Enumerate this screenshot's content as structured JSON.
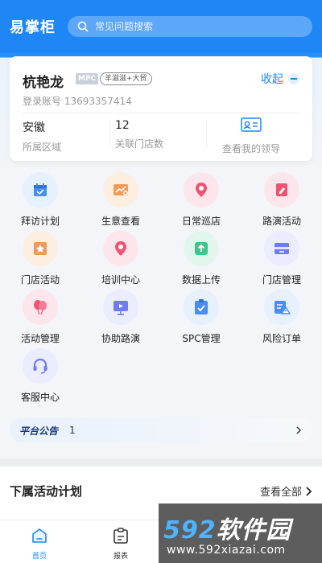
{
  "app": {
    "title": "易掌柜"
  },
  "search": {
    "placeholder": "常见问题搜索"
  },
  "profile": {
    "name": "杭艳龙",
    "role_badge": "MPC",
    "tag": "羊滋滋+大贸",
    "collapse_label": "收起",
    "account_label": "登录账号",
    "account_value": "13693357414",
    "region_value": "安徽",
    "region_label": "所属区域",
    "stores_value": "12",
    "stores_label": "关联门店数",
    "leader_label": "查看我的领导"
  },
  "menu": [
    {
      "label": "拜访计划",
      "icon": "calendar-icon",
      "color": "#4a8df2",
      "bg": "#e7f0fd"
    },
    {
      "label": "生意查看",
      "icon": "business-chart-icon",
      "color": "#f29a55",
      "bg": "#fdeee2"
    },
    {
      "label": "日常巡店",
      "icon": "location-pin-icon",
      "color": "#ee5472",
      "bg": "#fde6eb"
    },
    {
      "label": "路演活动",
      "icon": "edit-note-icon",
      "color": "#ee5472",
      "bg": "#fde6eb"
    },
    {
      "label": "门店活动",
      "icon": "star-card-icon",
      "color": "#f29a55",
      "bg": "#fdeee2"
    },
    {
      "label": "培训中心",
      "icon": "location-pin-icon",
      "color": "#ee5472",
      "bg": "#fde6eb"
    },
    {
      "label": "数据上传",
      "icon": "upload-icon",
      "color": "#3cc58d",
      "bg": "#e3f6ed"
    },
    {
      "label": "门店管理",
      "icon": "store-card-icon",
      "color": "#6f7bf0",
      "bg": "#ebecfd"
    },
    {
      "label": "活动管理",
      "icon": "balloons-icon",
      "color": "#ee5472",
      "bg": "#fde6eb"
    },
    {
      "label": "协助路演",
      "icon": "presentation-icon",
      "color": "#6f7bf0",
      "bg": "#ebecfd"
    },
    {
      "label": "SPC管理",
      "icon": "check-board-icon",
      "color": "#4a8df2",
      "bg": "#e7f0fd"
    },
    {
      "label": "风险订单",
      "icon": "warning-list-icon",
      "color": "#4a8df2",
      "bg": "#e7f0fd"
    },
    {
      "label": "客服中心",
      "icon": "headset-icon",
      "color": "#6f7bf0",
      "bg": "#ebecfd"
    }
  ],
  "notice": {
    "title": "平台公告",
    "count": "1"
  },
  "plans": {
    "title": "下属活动计划",
    "view_all": "查看全部"
  },
  "tabs": [
    {
      "label": "首页",
      "icon": "home-icon",
      "active": true
    },
    {
      "label": "报表",
      "icon": "report-icon",
      "active": false
    }
  ],
  "watermark": {
    "brand": "592软件园",
    "url": "www.592xiazai.com"
  },
  "colors": {
    "primary": "#1f86f5",
    "card": "#ffffff",
    "background": "#f3f5f8"
  }
}
